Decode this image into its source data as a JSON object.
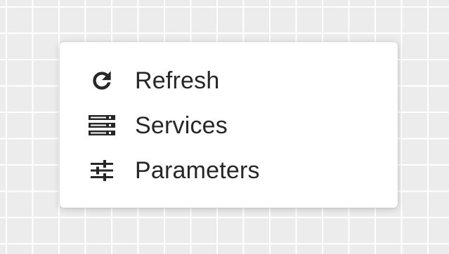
{
  "menu": {
    "items": [
      {
        "label": "Refresh",
        "icon": "refresh-icon"
      },
      {
        "label": "Services",
        "icon": "server-stack-icon"
      },
      {
        "label": "Parameters",
        "icon": "sliders-icon"
      }
    ]
  },
  "colors": {
    "text": "#262626",
    "icon": "#262626",
    "menu_background": "#ffffff",
    "page_background": "#ececec",
    "grid_lines": "#ffffff"
  }
}
